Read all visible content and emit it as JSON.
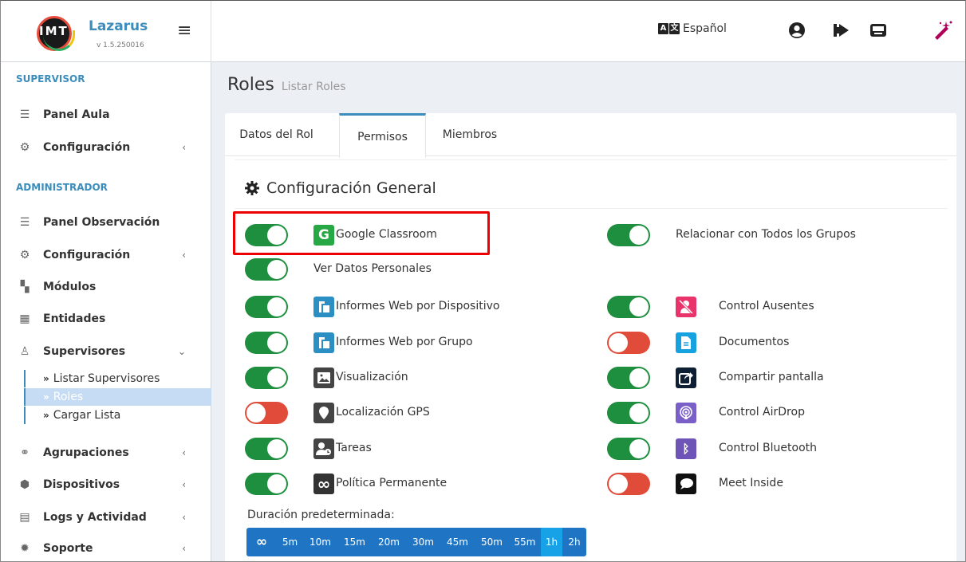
{
  "header": {
    "logo_text": "IMT",
    "app_name": "Lazarus",
    "version": "v 1.5.250016",
    "language_label": "Español",
    "icons": [
      "user-icon",
      "logout-icon",
      "device-icon",
      "magic-wand-icon"
    ]
  },
  "sidebar": {
    "sections": [
      {
        "title": "SUPERVISOR"
      },
      {
        "title": "ADMINISTRADOR"
      }
    ],
    "items": [
      {
        "label": "Panel Aula",
        "icon": "list-icon"
      },
      {
        "label": "Configuración",
        "icon": "cogs-icon"
      },
      {
        "label": "Panel Observación",
        "icon": "list-icon"
      },
      {
        "label": "Configuración",
        "icon": "cogs-icon"
      },
      {
        "label": "Módulos",
        "icon": "puzzle-icon"
      },
      {
        "label": "Entidades",
        "icon": "building-icon"
      },
      {
        "label": "Supervisores",
        "icon": "users-icon"
      },
      {
        "label": "Agrupaciones",
        "icon": "groups-icon"
      },
      {
        "label": "Dispositivos",
        "icon": "box-icon"
      },
      {
        "label": "Logs y Actividad",
        "icon": "file-icon"
      },
      {
        "label": "Soporte",
        "icon": "gear-icon"
      }
    ],
    "subitems": [
      {
        "label": "Listar Supervisores",
        "active": false
      },
      {
        "label": "Roles",
        "active": true
      },
      {
        "label": "Cargar Lista",
        "active": false
      }
    ]
  },
  "page": {
    "title": "Roles",
    "subtitle": "Listar Roles"
  },
  "tabs": [
    {
      "label": "Datos del Rol",
      "active": false
    },
    {
      "label": "Permisos",
      "active": true
    },
    {
      "label": "Miembros",
      "active": false
    }
  ],
  "section": {
    "title": "Configuración General"
  },
  "permissions_left": [
    {
      "label": "Google Classroom",
      "on": true,
      "icon": "google-icon",
      "color": "#28a745"
    },
    {
      "label": "Ver Datos Personales",
      "on": true,
      "icon": "",
      "color": ""
    },
    {
      "label": "Informes Web por Dispositivo",
      "on": true,
      "icon": "report-icon",
      "color": "#2b8fc4"
    },
    {
      "label": "Informes Web por Grupo",
      "on": true,
      "icon": "report-icon",
      "color": "#2b8fc4"
    },
    {
      "label": "Visualización",
      "on": true,
      "icon": "image-icon",
      "color": "#444444"
    },
    {
      "label": "Localización GPS",
      "on": false,
      "icon": "location-icon",
      "color": "#444444"
    },
    {
      "label": "Tareas",
      "on": true,
      "icon": "tasks-icon",
      "color": "#444444"
    },
    {
      "label": "Política Permanente",
      "on": true,
      "icon": "infinity-icon",
      "color": "#333333"
    }
  ],
  "permissions_right": [
    {
      "label": "Relacionar con Todos los Grupos",
      "on": true,
      "icon": "",
      "color": ""
    },
    {
      "label": "Control Ausentes",
      "on": true,
      "icon": "user-slash-icon",
      "color": "#e8336b"
    },
    {
      "label": "Documentos",
      "on": false,
      "icon": "document-icon",
      "color": "#16a2e0"
    },
    {
      "label": "Compartir pantalla",
      "on": true,
      "icon": "share-icon",
      "color": "#0e1e33"
    },
    {
      "label": "Control AirDrop",
      "on": true,
      "icon": "airdrop-icon",
      "color": "#7b5fc9"
    },
    {
      "label": "Control Bluetooth",
      "on": true,
      "icon": "bluetooth-icon",
      "color": "#6f54b8"
    },
    {
      "label": "Meet Inside",
      "on": false,
      "icon": "chat-icon",
      "color": "#111111"
    }
  ],
  "duration": {
    "label": "Duración predeterminada:",
    "options": [
      "∞",
      "5m",
      "10m",
      "15m",
      "20m",
      "30m",
      "45m",
      "50m",
      "55m",
      "1h",
      "2h"
    ],
    "selected": "1h"
  }
}
